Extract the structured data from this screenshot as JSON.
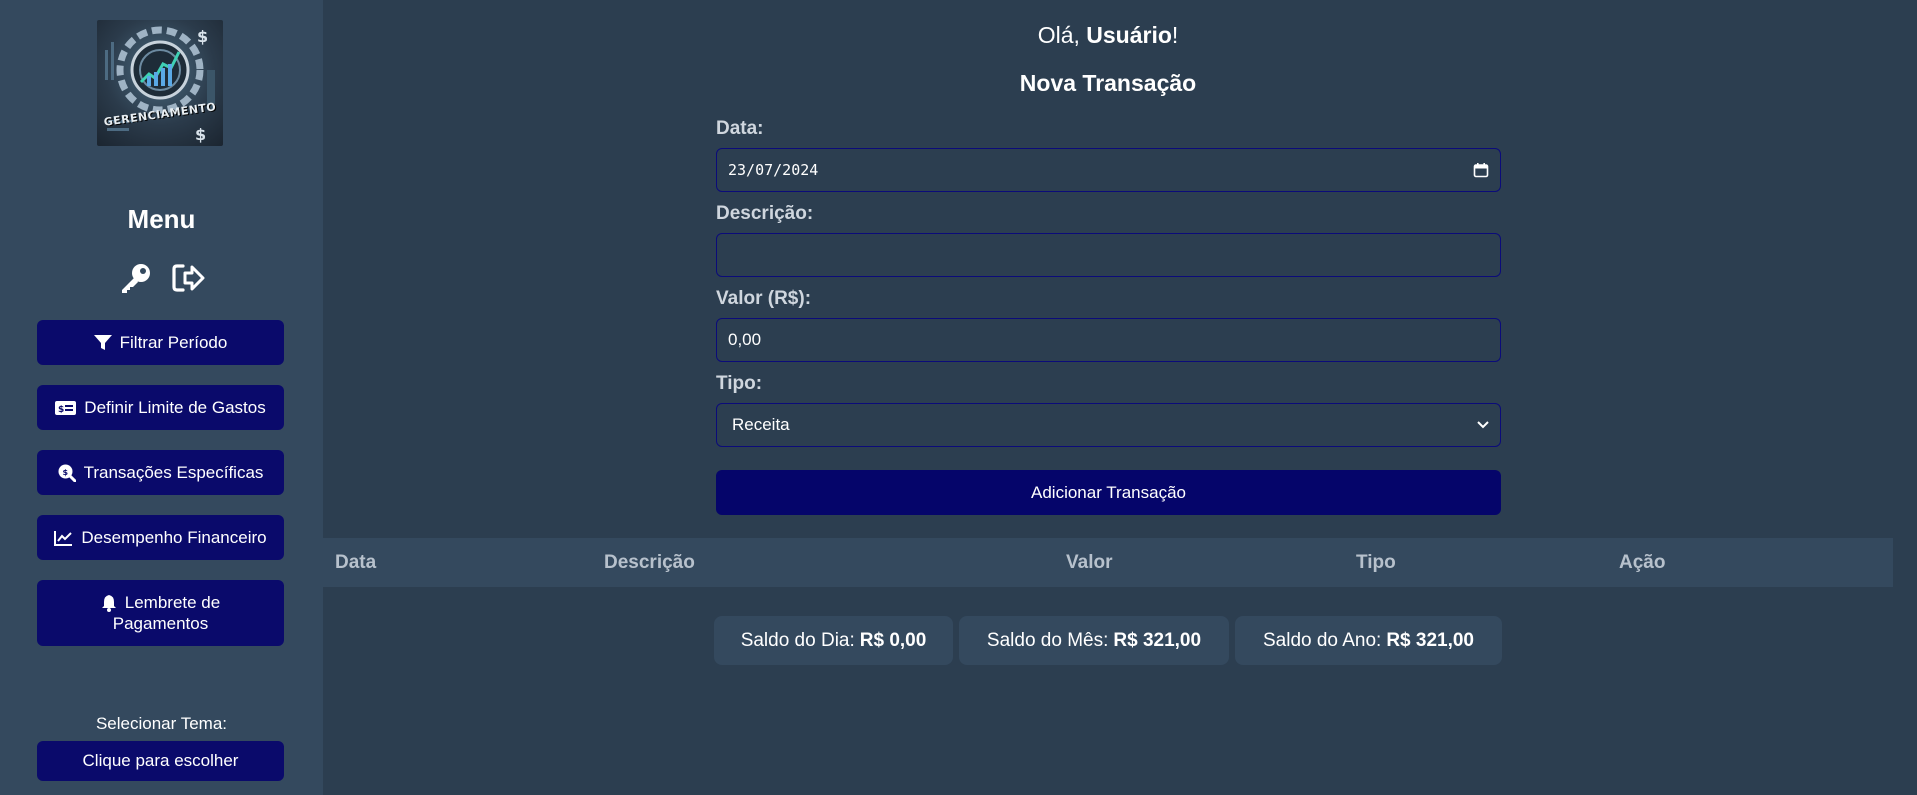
{
  "sidebar": {
    "logo_text": "GERENCIAMENTO",
    "menu_title": "Menu",
    "icons": [
      "key-icon",
      "sign-out-icon"
    ],
    "buttons": [
      {
        "label": "Filtrar Período",
        "icon": "filter-icon"
      },
      {
        "label": "Definir Limite de Gastos",
        "icon": "money-bill-icon"
      },
      {
        "label": "Transações Específicas",
        "icon": "search-dollar-icon"
      },
      {
        "label": "Desempenho Financeiro",
        "icon": "chart-line-icon"
      },
      {
        "label_line1": "Lembrete de",
        "label_line2": "Pagamentos",
        "icon": "bell-icon"
      }
    ],
    "theme_label": "Selecionar Tema:",
    "theme_button": "Clique para escolher"
  },
  "header": {
    "greeting_prefix": "Olá, ",
    "user_name": "Usuário",
    "greeting_suffix": "!"
  },
  "form": {
    "title": "Nova Transação",
    "date_label": "Data:",
    "date_value": "23/07/2024",
    "description_label": "Descrição:",
    "description_value": "",
    "value_label": "Valor (R$):",
    "value_value": "0,00",
    "type_label": "Tipo:",
    "type_selected": "Receita",
    "submit_label": "Adicionar Transação"
  },
  "table": {
    "columns": [
      "Data",
      "Descrição",
      "Valor",
      "Tipo",
      "Ação"
    ],
    "rows": []
  },
  "balances": [
    {
      "label": "Saldo do Dia:",
      "value": "R$ 0,00"
    },
    {
      "label": "Saldo do Mês:",
      "value": "R$ 321,00"
    },
    {
      "label": "Saldo do Ano:",
      "value": "R$ 321,00"
    }
  ],
  "colors": {
    "background": "#2c3e50",
    "sidebar": "#34495e",
    "button": "#0a0a6b",
    "field_border": "#0b0b7a"
  }
}
